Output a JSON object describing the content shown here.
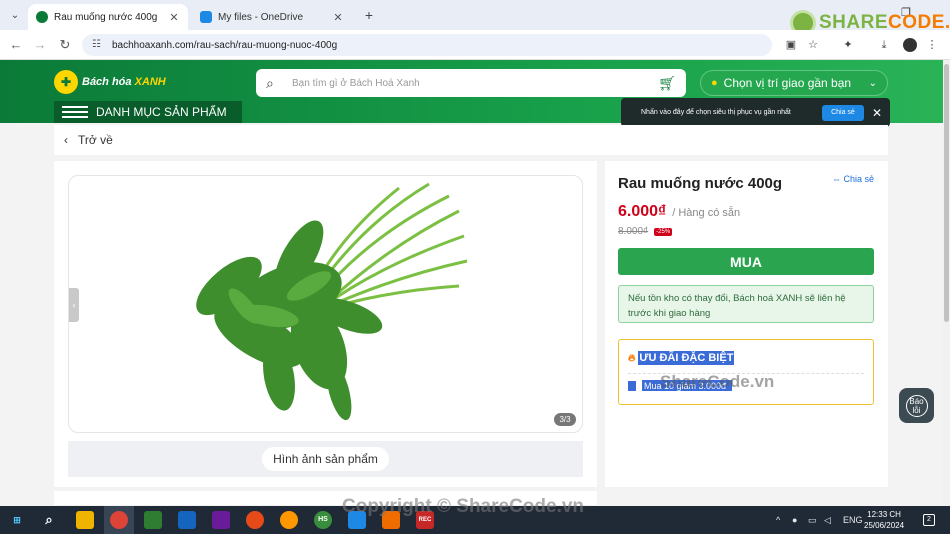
{
  "browser": {
    "tabs": [
      {
        "title": "Rau muống nước 400g",
        "active": true
      },
      {
        "title": "My files - OneDrive",
        "active": false
      }
    ],
    "url": "bachhoaxanh.com/rau-sach/rau-muong-nuoc-400g"
  },
  "sharecode_logo": {
    "prefix": "SHARE",
    "suffix": "CODE.vn"
  },
  "header": {
    "brand": {
      "part1": "Bách hóa",
      "part2": "XANH"
    },
    "search_placeholder": "Bạn tìm gì ở Bách Hoá Xanh",
    "location_label": "Chọn vị trí giao gần bạn",
    "category_label": "DANH MỤC SẢN PHẨM",
    "tooltip": {
      "message": "Nhấn vào đây để chọn siêu thị phục vụ gần nhất",
      "share": "Chia sẻ"
    }
  },
  "back_label": "Trở về",
  "gallery": {
    "counter": "3/3",
    "thumb_label": "Hình ảnh sản phẩm"
  },
  "product": {
    "title": "Rau muống nước 400g",
    "share_label": "Chia sẻ",
    "price": "6.000₫",
    "stock": "/ Hàng có sẵn",
    "old_price": "8.000₫",
    "discount": "-25%",
    "buy_label": "MUA",
    "notice": "Nếu tồn kho có thay đổi, Bách hoá XANH sẽ liên hệ trước khi giao hàng",
    "promo_title": "ƯU ĐÃI ĐẶC BIỆT",
    "promo_item": "Mua 10 giảm 3.000đ"
  },
  "report_label": "Báo lỗi",
  "watermarks": {
    "mid": "ShareCode.vn",
    "bottom": "Copyright © ShareCode.vn"
  },
  "taskbar": {
    "time": "12:33 CH",
    "date": "25/06/2024",
    "lang": "ENG",
    "notif_count": "2"
  }
}
